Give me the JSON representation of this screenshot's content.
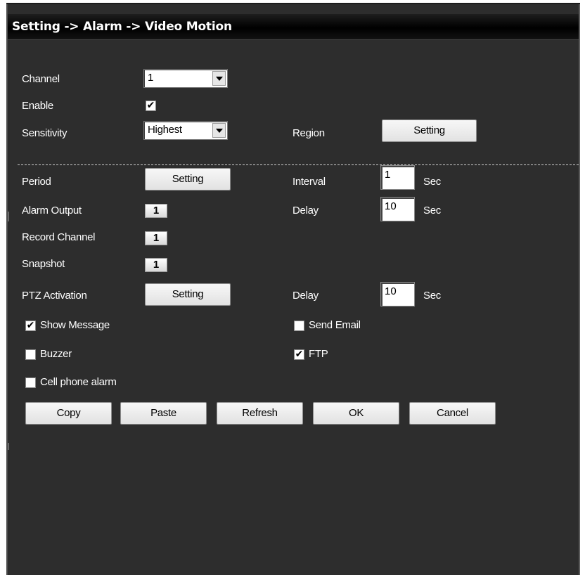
{
  "title": "Setting -> Alarm -> Video Motion",
  "channel": {
    "label": "Channel",
    "value": "1"
  },
  "enable": {
    "label": "Enable",
    "checked": true
  },
  "sensitivity": {
    "label": "Sensitivity",
    "value": "Highest"
  },
  "region": {
    "label": "Region",
    "button": "Setting"
  },
  "period": {
    "label": "Period",
    "button": "Setting"
  },
  "interval": {
    "label": "Interval",
    "value": "1",
    "unit": "Sec"
  },
  "alarm_output": {
    "label": "Alarm Output",
    "value": "1"
  },
  "delay1": {
    "label": "Delay",
    "value": "10",
    "unit": "Sec"
  },
  "record_channel": {
    "label": "Record Channel",
    "value": "1"
  },
  "snapshot": {
    "label": "Snapshot",
    "value": "1"
  },
  "ptz": {
    "label": "PTZ Activation",
    "button": "Setting"
  },
  "delay2": {
    "label": "Delay",
    "value": "10",
    "unit": "Sec"
  },
  "show_message": {
    "label": "Show Message",
    "checked": true
  },
  "send_email": {
    "label": "Send Email",
    "checked": false
  },
  "buzzer": {
    "label": "Buzzer",
    "checked": false
  },
  "ftp": {
    "label": "FTP",
    "checked": true
  },
  "cell_phone_alarm": {
    "label": "Cell phone alarm",
    "checked": false
  },
  "actions": {
    "copy": "Copy",
    "paste": "Paste",
    "refresh": "Refresh",
    "ok": "OK",
    "cancel": "Cancel"
  },
  "check_glyph": "✔",
  "colors": {
    "panel_bg": "#2d2d2d",
    "titlebar_bg": "#000000",
    "text": "#ffffff"
  }
}
